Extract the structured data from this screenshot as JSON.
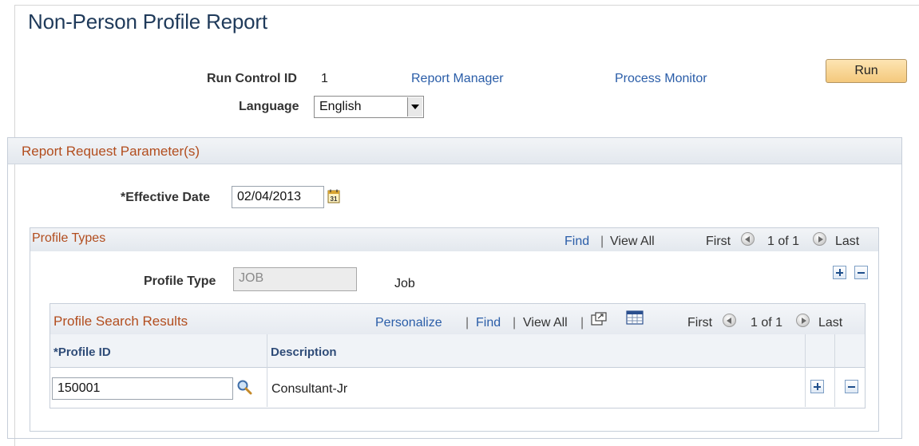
{
  "page": {
    "title": "Non-Person Profile Report"
  },
  "run_control": {
    "label": "Run Control ID",
    "value": "1",
    "report_manager_link": "Report Manager",
    "process_monitor_link": "Process Monitor",
    "run_button": "Run"
  },
  "language": {
    "label": "Language",
    "value": "English"
  },
  "parameters": {
    "title": "Report Request Parameter(s)",
    "effective_date_label": "*Effective Date",
    "effective_date_value": "02/04/2013",
    "calendar_icon": "calendar-icon"
  },
  "profile_types": {
    "title": "Profile Types",
    "find_link": "Find",
    "view_all_link": "View All",
    "first": "First",
    "counter": "1 of 1",
    "last": "Last",
    "profile_type_label": "Profile Type",
    "profile_type_value": "JOB",
    "profile_type_desc": "Job"
  },
  "search_results": {
    "title": "Profile Search Results",
    "personalize_link": "Personalize",
    "find_link": "Find",
    "view_all_link": "View All",
    "first": "First",
    "counter": "1 of 1",
    "last": "Last",
    "columns": [
      "*Profile ID",
      "Description"
    ],
    "rows": [
      {
        "profile_id": "150001",
        "description": "Consultant-Jr"
      }
    ]
  },
  "separator": "|",
  "colors": {
    "title": "#1f3a5a",
    "link": "#2a5da8",
    "section_title": "#b24d1e",
    "run_button": "#f4c97c"
  }
}
